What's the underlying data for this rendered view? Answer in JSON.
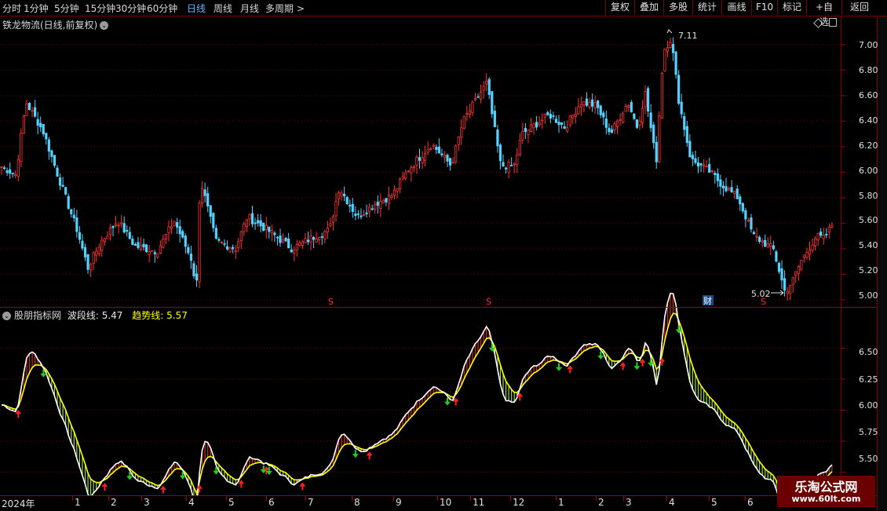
{
  "toolbar": {
    "periods": [
      "分时",
      "1分钟",
      "5分钟",
      "15分钟",
      "30分钟",
      "60分钟",
      "日线",
      "周线",
      "月线",
      "多周期 >"
    ],
    "active_index": 6,
    "right_buttons": [
      "复权",
      "叠加",
      "多股",
      "统计",
      "画线",
      "F10",
      "标记",
      "+自选",
      "返回"
    ]
  },
  "stock": {
    "title": "铁龙物流(日线,前复权)",
    "dropdown_icon": "chevron-down-icon"
  },
  "indicator": {
    "name": "股朋指标网",
    "wave_label": "波段线:",
    "wave_value": "5.47",
    "trend_label": "趋势线:",
    "trend_value": "5.57"
  },
  "main_axis": {
    "labels": [
      "7.00",
      "6.80",
      "6.60",
      "6.40",
      "6.20",
      "6.00",
      "5.80",
      "5.60",
      "5.40",
      "5.20",
      "5.00"
    ],
    "min": 4.95,
    "max": 7.22
  },
  "ind_axis": {
    "labels": [
      "6.50",
      "6.25",
      "6.00",
      "5.75",
      "5.50"
    ],
    "min": 5.32,
    "max": 6.82
  },
  "annotations": {
    "high": "7.11",
    "low": "5.02",
    "markers": [
      "S",
      "S",
      "S"
    ],
    "cai": "财"
  },
  "x_axis": {
    "labels": [
      "2024年",
      "1",
      "2",
      "3",
      "4",
      "5",
      "6",
      "7",
      "8",
      "9",
      "10",
      "11",
      "12",
      "1",
      "2",
      "3",
      "4",
      "5",
      "6"
    ]
  },
  "watermark": {
    "line1": "乐淘公式网",
    "line2": "www.60lt.com"
  },
  "colors": {
    "up": "#ff3232",
    "down": "#54d2ff",
    "trend": "#ffff00",
    "wave": "#ffffff",
    "grid": "#6a0000",
    "border": "#a00000"
  },
  "chart_data": {
    "type": "candlestick",
    "keypoints": [
      [
        0,
        6.05
      ],
      [
        20,
        5.98
      ],
      [
        33,
        6.55
      ],
      [
        55,
        6.32
      ],
      [
        75,
        5.95
      ],
      [
        98,
        5.55
      ],
      [
        112,
        5.25
      ],
      [
        128,
        5.45
      ],
      [
        150,
        5.62
      ],
      [
        172,
        5.42
      ],
      [
        200,
        5.38
      ],
      [
        222,
        5.62
      ],
      [
        245,
        5.3
      ],
      [
        250,
        5.05
      ],
      [
        255,
        5.95
      ],
      [
        275,
        5.46
      ],
      [
        300,
        5.4
      ],
      [
        315,
        5.65
      ],
      [
        340,
        5.55
      ],
      [
        372,
        5.4
      ],
      [
        395,
        5.48
      ],
      [
        420,
        5.55
      ],
      [
        432,
        5.88
      ],
      [
        455,
        5.65
      ],
      [
        480,
        5.76
      ],
      [
        500,
        5.82
      ],
      [
        520,
        6.02
      ],
      [
        550,
        6.22
      ],
      [
        575,
        6.05
      ],
      [
        590,
        6.4
      ],
      [
        620,
        6.7
      ],
      [
        638,
        6.05
      ],
      [
        655,
        6.05
      ],
      [
        665,
        6.3
      ],
      [
        700,
        6.45
      ],
      [
        720,
        6.35
      ],
      [
        740,
        6.55
      ],
      [
        760,
        6.52
      ],
      [
        778,
        6.3
      ],
      [
        800,
        6.55
      ],
      [
        812,
        6.35
      ],
      [
        822,
        6.62
      ],
      [
        836,
        6.08
      ],
      [
        845,
        6.95
      ],
      [
        855,
        7.05
      ],
      [
        865,
        6.55
      ],
      [
        880,
        6.1
      ],
      [
        905,
        6.0
      ],
      [
        920,
        5.9
      ],
      [
        940,
        5.8
      ],
      [
        960,
        5.5
      ],
      [
        985,
        5.4
      ],
      [
        1000,
        5.06
      ],
      [
        1010,
        5.15
      ],
      [
        1020,
        5.3
      ],
      [
        1040,
        5.5
      ],
      [
        1050,
        5.48
      ],
      [
        1063,
        5.62
      ]
    ],
    "highest": 7.11,
    "lowest": 5.02
  }
}
